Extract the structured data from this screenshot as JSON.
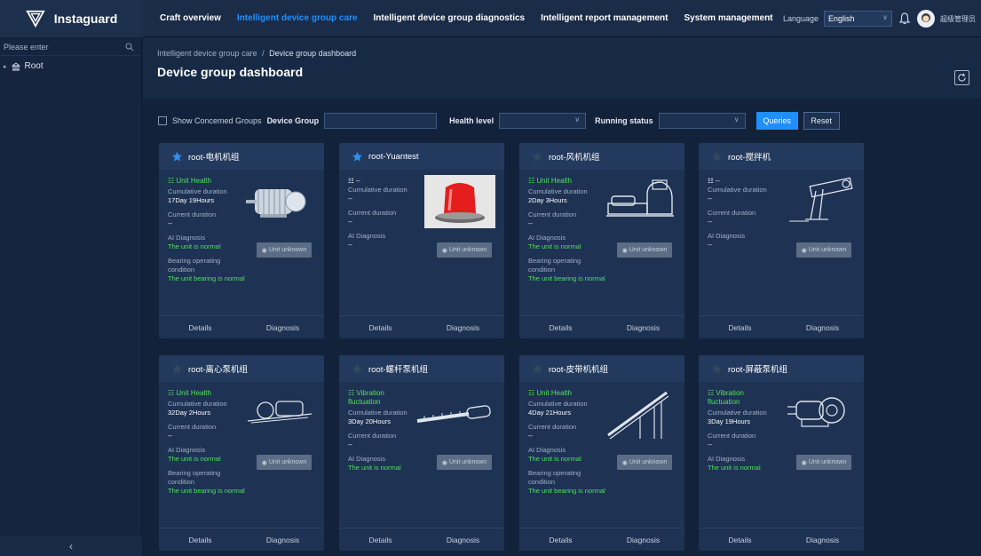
{
  "app": {
    "brand": "Instaguard"
  },
  "nav": [
    {
      "label": "Craft overview",
      "active": false
    },
    {
      "label": "Intelligent device group care",
      "active": true
    },
    {
      "label": "Intelligent device group diagnostics",
      "active": false
    },
    {
      "label": "Intelligent report management",
      "active": false
    },
    {
      "label": "System management",
      "active": false
    }
  ],
  "topright": {
    "language_label": "Language",
    "language_value": "English",
    "username": "超级管理员"
  },
  "sidebar": {
    "search_placeholder": "Please enter",
    "root_label": "Root"
  },
  "breadcrumb": {
    "parent": "Intelligent device group care",
    "sep": "/",
    "current": "Device group dashboard"
  },
  "page_title": "Device group dashboard",
  "filters": {
    "concerned": "Show Concemed Groups",
    "device_group_label": "Device Group",
    "health_label": "Health level",
    "running_label": "Running status",
    "query": "Queries",
    "reset": "Reset"
  },
  "labels": {
    "cumulative": "Cumulative duration",
    "current": "Current duration",
    "ai": "AI Diagnosis",
    "bearing": "Bearing operating condition",
    "unknown": "Unit unknown",
    "details": "Details",
    "diagnosis": "Diagnosis"
  },
  "cards": [
    {
      "name": "root-电机机组",
      "starred": true,
      "health": "Unit Health",
      "cumulative": "17Day 19Hours",
      "current": "--",
      "ai": "The unit is normal",
      "bearing": "The unit bearing is normal",
      "image": "motor"
    },
    {
      "name": "root-Yuantest",
      "starred": true,
      "health": "--",
      "cumulative": "--",
      "current": "--",
      "ai": "--",
      "bearing": "",
      "image": "alarm"
    },
    {
      "name": "root-风机机组",
      "starred": false,
      "health": "Unit Health",
      "cumulative": "2Day 3Hours",
      "current": "--",
      "ai": "The unit is normal",
      "bearing": "The unit bearing is normal",
      "image": "fan"
    },
    {
      "name": "root-搅拌机",
      "starred": false,
      "health": "--",
      "cumulative": "--",
      "current": "--",
      "ai": "--",
      "bearing": "",
      "image": "mixer"
    },
    {
      "name": "root-离心泵机组",
      "starred": false,
      "health": "Unit Health",
      "cumulative": "32Day 2Hours",
      "current": "--",
      "ai": "The unit is normal",
      "bearing": "The unit bearing is normal",
      "image": "pump"
    },
    {
      "name": "root-螺杆泵机组",
      "starred": false,
      "health": "Vibration fluctuation",
      "cumulative": "3Day 20Hours",
      "current": "--",
      "ai": "The unit is normal",
      "bearing": "",
      "image": "screw"
    },
    {
      "name": "root-皮带机机组",
      "starred": false,
      "health": "Unit Health",
      "cumulative": "4Day 21Hours",
      "current": "--",
      "ai": "The unit is normal",
      "bearing": "The unit bearing is normal",
      "image": "belt"
    },
    {
      "name": "root-屏蔽泵机组",
      "starred": false,
      "health": "Vibration fluctuation",
      "cumulative": "3Day 19Hours",
      "current": "--",
      "ai": "The unit is normal",
      "bearing": "",
      "image": "canned"
    }
  ],
  "colors": {
    "accent": "#1f8fff",
    "healthy": "#4fe35d",
    "star_active": "#2f8ff0",
    "star_inactive": "#33475f"
  }
}
